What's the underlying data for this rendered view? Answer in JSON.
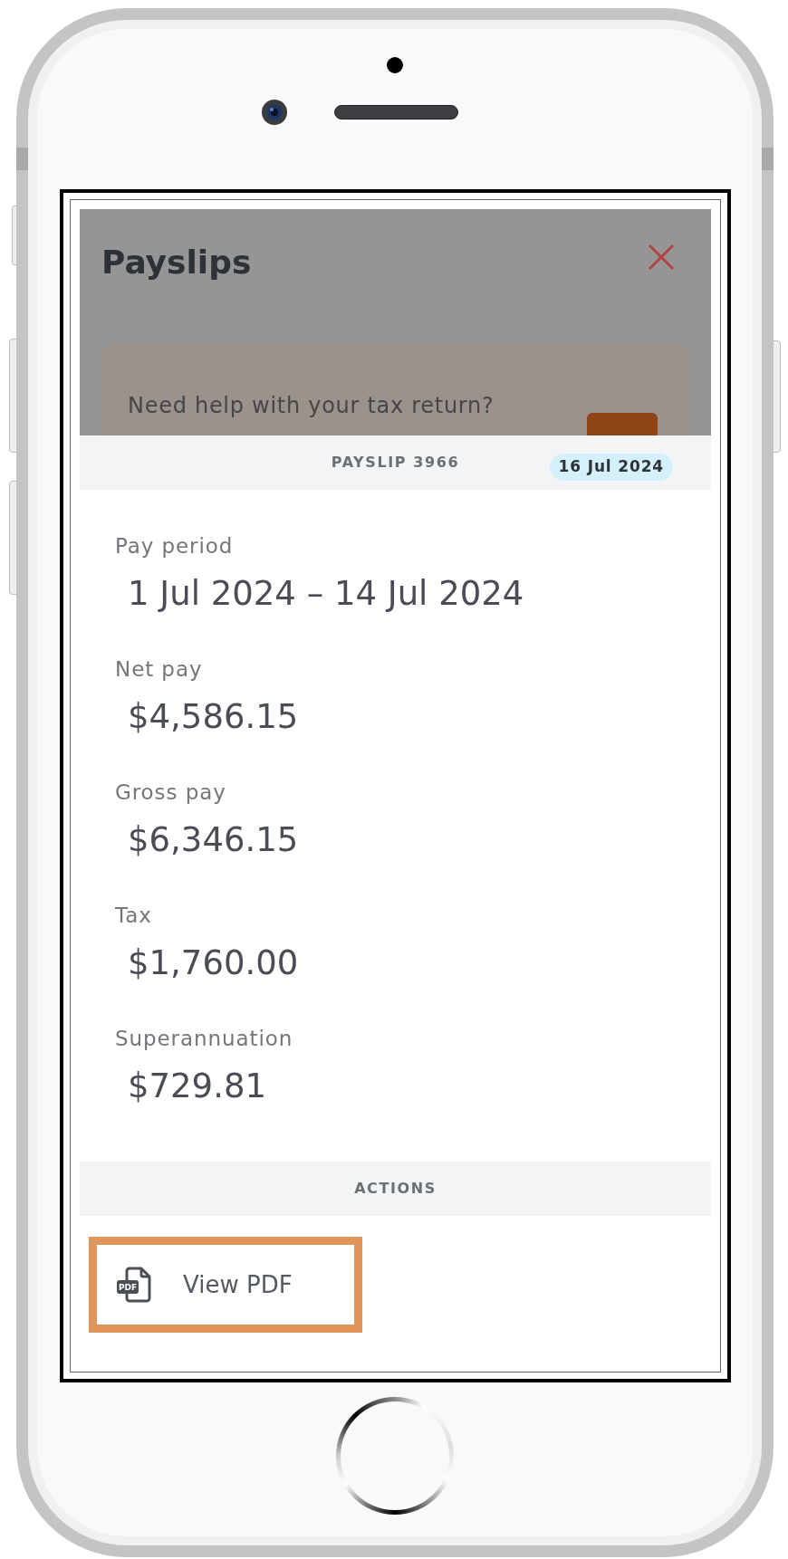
{
  "background": {
    "dimmed": true,
    "title": "Payslips",
    "banner": {
      "text": "Need help with your tax return?"
    }
  },
  "sheet": {
    "header": {
      "title": "PAYSLIP 3966",
      "date_badge": "16 Jul 2024"
    },
    "fields": [
      {
        "label": "Pay period",
        "value": "1 Jul 2024 – 14 Jul 2024"
      },
      {
        "label": "Net pay",
        "value": "$4,586.15"
      },
      {
        "label": "Gross pay",
        "value": "$6,346.15"
      },
      {
        "label": "Tax",
        "value": "$1,760.00"
      },
      {
        "label": "Superannuation",
        "value": "$729.81"
      }
    ],
    "actions": {
      "title": "ACTIONS",
      "items": [
        {
          "label": "View PDF",
          "icon_text": "PDF",
          "highlighted": true
        }
      ]
    }
  }
}
